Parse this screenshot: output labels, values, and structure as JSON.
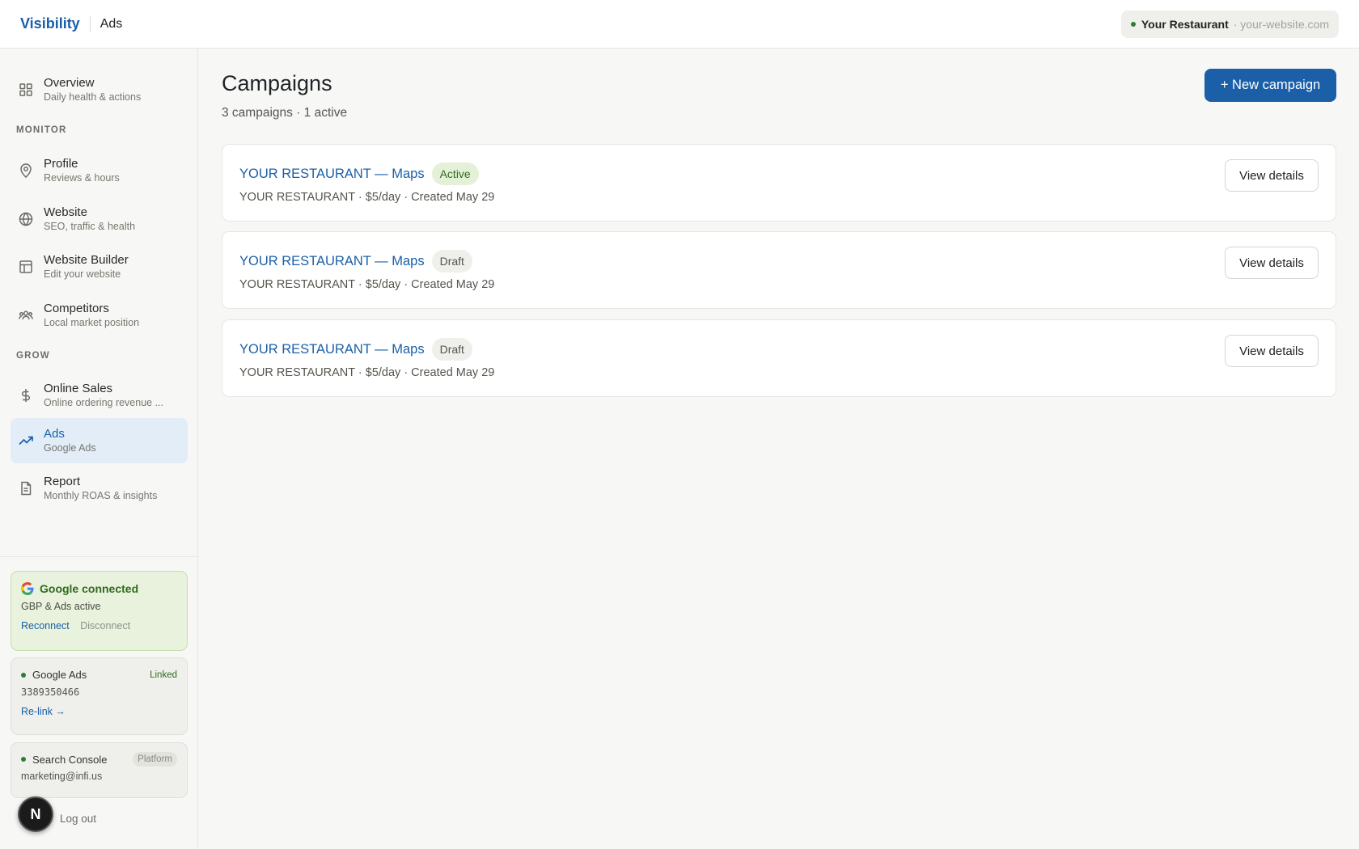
{
  "topbar": {
    "brand": "Visibility",
    "crumb": "Ads",
    "site_name": "Your Restaurant",
    "site_url": "· your-website.com"
  },
  "sidebar": {
    "overview": {
      "title": "Overview",
      "sub": "Daily health & actions",
      "icon": "grid-icon"
    },
    "monitor_label": "MONITOR",
    "monitor": [
      {
        "title": "Profile",
        "sub": "Reviews & hours",
        "icon": "map-pin-icon"
      },
      {
        "title": "Website",
        "sub": "SEO, traffic & health",
        "icon": "globe-icon"
      },
      {
        "title": "Website Builder",
        "sub": "Edit your website",
        "icon": "layout-icon"
      },
      {
        "title": "Competitors",
        "sub": "Local market position",
        "icon": "users-icon"
      }
    ],
    "grow_label": "GROW",
    "grow": [
      {
        "title": "Online Sales",
        "sub": "Online ordering revenue ...",
        "icon": "dollar-icon"
      },
      {
        "title": "Ads",
        "sub": "Google Ads",
        "icon": "trending-up-icon",
        "active": true
      },
      {
        "title": "Report",
        "sub": "Monthly ROAS & insights",
        "icon": "document-icon"
      }
    ],
    "google_card": {
      "title": "Google connected",
      "sub": "GBP & Ads active",
      "reconnect": "Reconnect",
      "disconnect": "Disconnect"
    },
    "ads_card": {
      "title": "Google Ads",
      "tag": "Linked",
      "account": "3389350466",
      "relink": "Re-link →"
    },
    "console_card": {
      "title": "Search Console",
      "tag": "Platform",
      "email": "marketing@infi.us"
    },
    "logout": "Log out",
    "fab_letter": "N"
  },
  "main": {
    "title": "Campaigns",
    "subtitle": "3 campaigns · 1 active",
    "new_button": "+ New campaign",
    "campaigns": [
      {
        "name": "YOUR RESTAURANT — Maps",
        "status": "Active",
        "meta": "YOUR RESTAURANT · $5/day · Created May 29",
        "action": "View details"
      },
      {
        "name": "YOUR RESTAURANT — Maps",
        "status": "Draft",
        "meta": "YOUR RESTAURANT · $5/day · Created May 29",
        "action": "View details"
      },
      {
        "name": "YOUR RESTAURANT — Maps",
        "status": "Draft",
        "meta": "YOUR RESTAURANT · $5/day · Created May 29",
        "action": "View details"
      }
    ]
  },
  "colors": {
    "accent": "#1a5fa8",
    "active_badge_bg": "#e4f1d8",
    "success": "#2e7d32",
    "background": "#f7f7f5"
  }
}
